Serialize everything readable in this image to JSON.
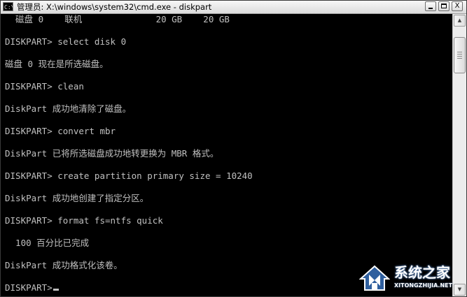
{
  "window": {
    "icon_label": "C:\\",
    "title": "管理员: X:\\windows\\system32\\cmd.exe - diskpart",
    "minimize_label": "",
    "maximize_label": "",
    "close_label": "X"
  },
  "console": {
    "lines": [
      "  磁盘 0    联机              20 GB    20 GB",
      "",
      "DISKPART> select disk 0",
      "",
      "磁盘 0 现在是所选磁盘。",
      "",
      "DISKPART> clean",
      "",
      "DiskPart 成功地清除了磁盘。",
      "",
      "DISKPART> convert mbr",
      "",
      "DiskPart 已将所选磁盘成功地转更换为 MBR 格式。",
      "",
      "DISKPART> create partition primary size = 10240",
      "",
      "DiskPart 成功地创建了指定分区。",
      "",
      "DISKPART> format fs=ntfs quick",
      "",
      "  100 百分比已完成",
      "",
      "DiskPart 成功格式化该卷。",
      "",
      "DISKPART>"
    ]
  },
  "scrollbar": {
    "up_arrow": "▲",
    "down_arrow": "▼"
  },
  "watermark": {
    "name": "系统之家",
    "url": "XITONGZHIJIA.NET"
  }
}
